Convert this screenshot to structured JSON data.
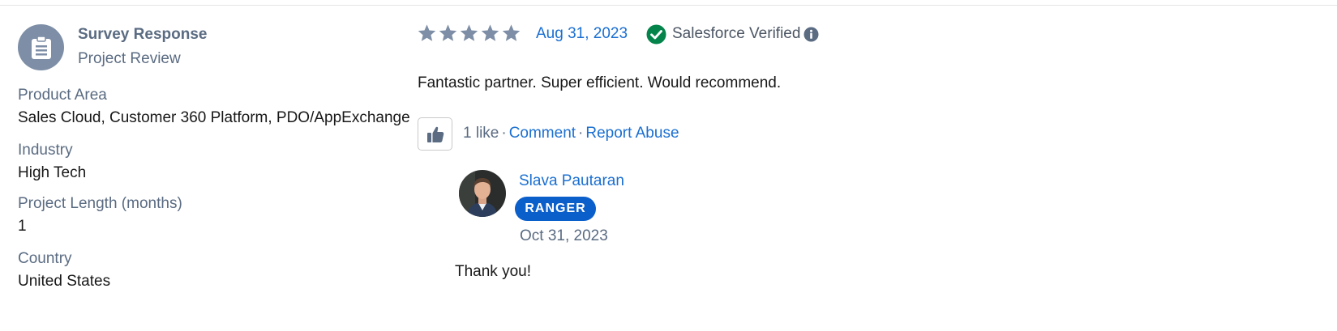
{
  "response": {
    "type": "Survey Response",
    "subtype": "Project Review",
    "icon": "clipboard-icon"
  },
  "fields": [
    {
      "label": "Product Area",
      "value": "Sales Cloud, Customer 360 Platform, PDO/AppExchange"
    },
    {
      "label": "Industry",
      "value": "High Tech"
    },
    {
      "label": "Project Length (months)",
      "value": "1"
    },
    {
      "label": "Country",
      "value": "United States"
    }
  ],
  "review": {
    "rating": 5,
    "rating_max": 5,
    "date": "Aug 31, 2023",
    "verified_label": "Salesforce Verified",
    "body": "Fantastic partner. Super efficient. Would recommend."
  },
  "actions": {
    "like_count": "1 like",
    "separator": "·",
    "comment": "Comment",
    "report": "Report Abuse"
  },
  "reply": {
    "author": "Slava Pautaran",
    "badge": "RANGER",
    "date": "Oct 31, 2023",
    "body": "Thank you!"
  },
  "colors": {
    "star": "#7d8ea6",
    "link": "#1a6fd1",
    "verified": "#04844b",
    "badge": "#0b5fcb",
    "muted": "#5a6b82"
  }
}
